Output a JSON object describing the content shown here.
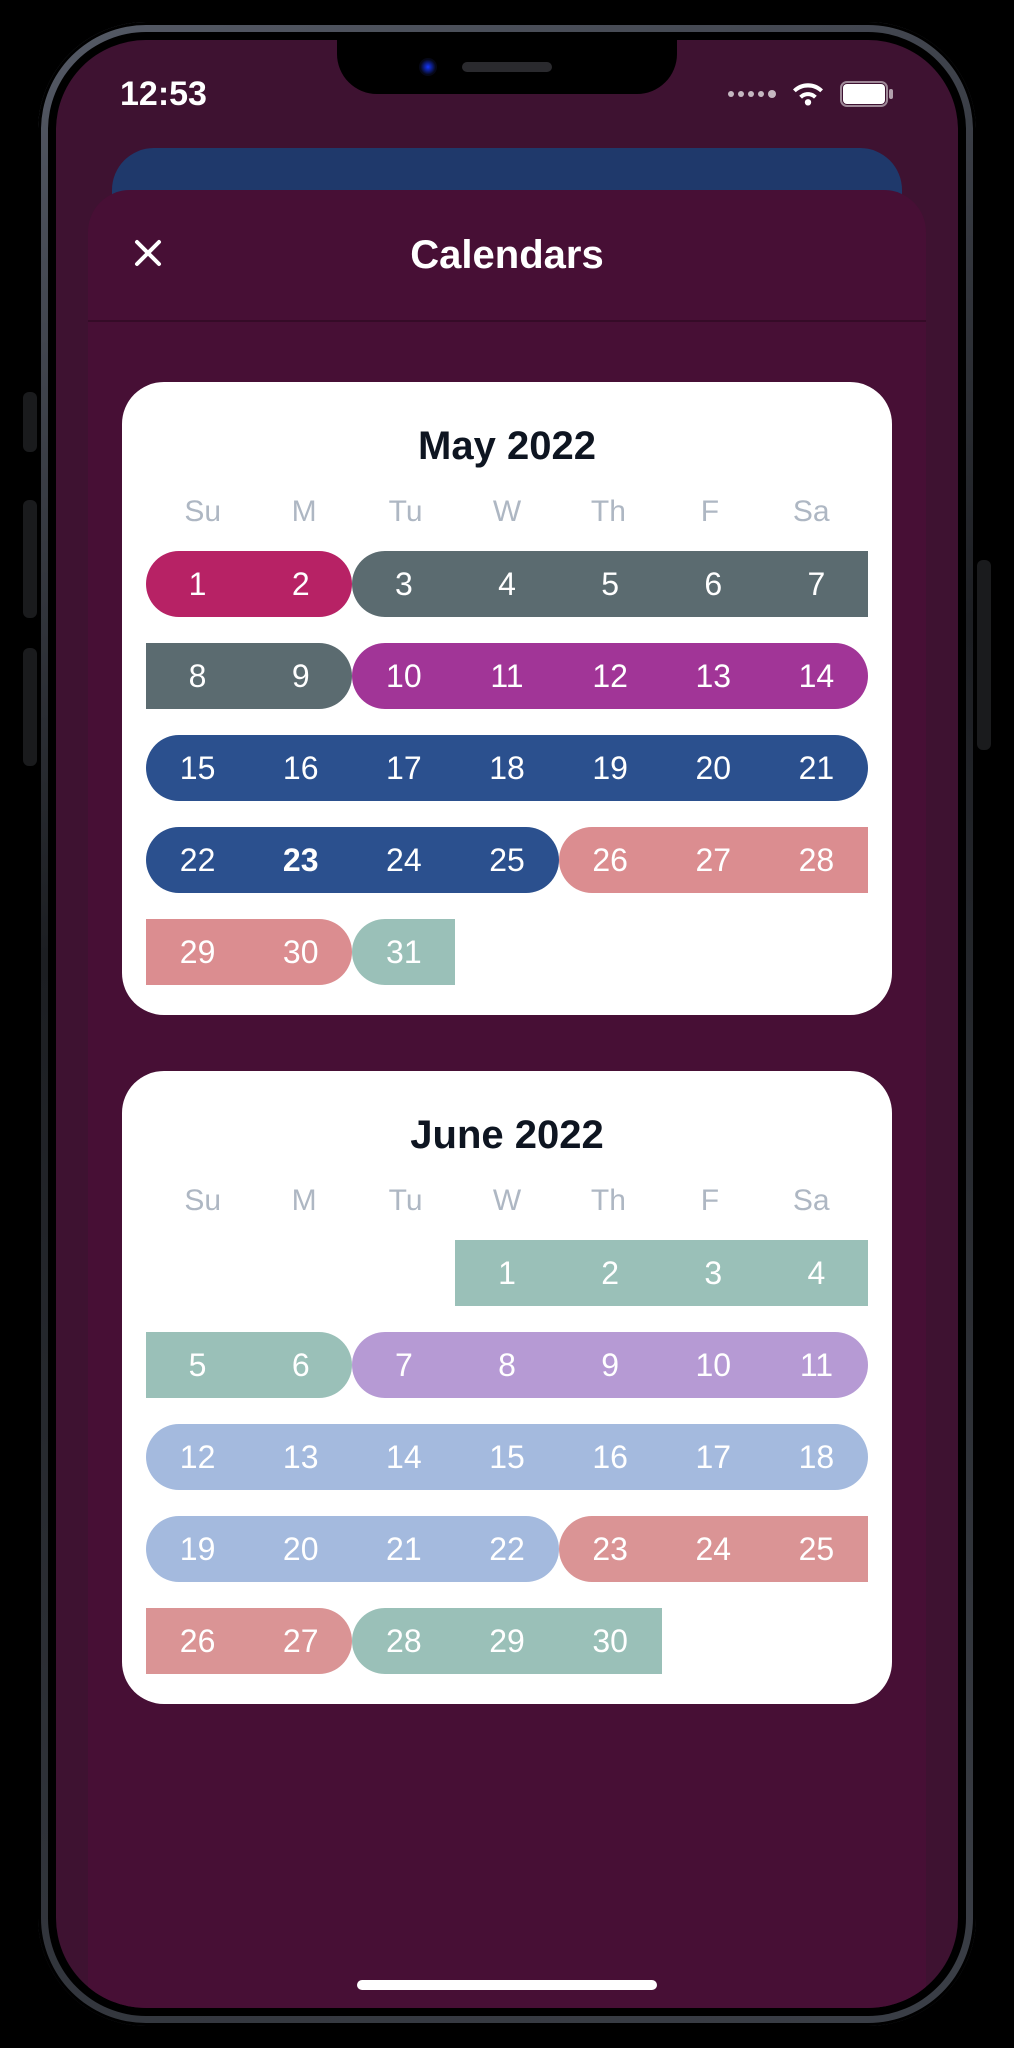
{
  "status": {
    "time": "12:53"
  },
  "header": {
    "title": "Calendars"
  },
  "colors": {
    "pink": "#b72265",
    "slate": "#5b6b70",
    "purple": "#a13597",
    "navy": "#2b508e",
    "salmon": "#db8d90",
    "teal": "#9ac0b8",
    "lavender": "#b69ad4",
    "skyblue": "#a4bade",
    "salmon2": "#da9495"
  },
  "weekdays": [
    "Su",
    "M",
    "Tu",
    "W",
    "Th",
    "F",
    "Sa"
  ],
  "months": [
    {
      "title": "May 2022",
      "weeks": [
        {
          "days": [
            1,
            2,
            3,
            4,
            5,
            6,
            7
          ],
          "segments": [
            {
              "start": 0,
              "end": 1,
              "color": "pink"
            },
            {
              "start": 2,
              "end": 6,
              "color": "slate",
              "openRight": true
            }
          ]
        },
        {
          "days": [
            8,
            9,
            10,
            11,
            12,
            13,
            14
          ],
          "segments": [
            {
              "start": 0,
              "end": 1,
              "color": "slate",
              "openLeft": true
            },
            {
              "start": 2,
              "end": 6,
              "color": "purple"
            }
          ]
        },
        {
          "days": [
            15,
            16,
            17,
            18,
            19,
            20,
            21
          ],
          "segments": [
            {
              "start": 0,
              "end": 6,
              "color": "navy"
            }
          ]
        },
        {
          "days": [
            22,
            23,
            24,
            25,
            26,
            27,
            28
          ],
          "bold": [
            23
          ],
          "segments": [
            {
              "start": 0,
              "end": 3,
              "color": "navy"
            },
            {
              "start": 4,
              "end": 6,
              "color": "salmon",
              "openRight": true
            }
          ]
        },
        {
          "days": [
            29,
            30,
            31,
            null,
            null,
            null,
            null
          ],
          "segments": [
            {
              "start": 0,
              "end": 1,
              "color": "salmon",
              "openLeft": true
            },
            {
              "start": 2,
              "end": 2,
              "color": "teal",
              "openRight": true
            }
          ]
        }
      ]
    },
    {
      "title": "June 2022",
      "weeks": [
        {
          "days": [
            null,
            null,
            null,
            1,
            2,
            3,
            4
          ],
          "segments": [
            {
              "start": 3,
              "end": 6,
              "color": "teal",
              "openLeft": true,
              "openRight": true
            }
          ]
        },
        {
          "days": [
            5,
            6,
            7,
            8,
            9,
            10,
            11
          ],
          "segments": [
            {
              "start": 0,
              "end": 1,
              "color": "teal",
              "openLeft": true
            },
            {
              "start": 2,
              "end": 6,
              "color": "lavender"
            }
          ]
        },
        {
          "days": [
            12,
            13,
            14,
            15,
            16,
            17,
            18
          ],
          "segments": [
            {
              "start": 0,
              "end": 6,
              "color": "skyblue"
            }
          ]
        },
        {
          "days": [
            19,
            20,
            21,
            22,
            23,
            24,
            25
          ],
          "segments": [
            {
              "start": 0,
              "end": 3,
              "color": "skyblue"
            },
            {
              "start": 4,
              "end": 6,
              "color": "salmon2",
              "openRight": true
            }
          ]
        },
        {
          "days": [
            26,
            27,
            28,
            29,
            30,
            null,
            null
          ],
          "segments": [
            {
              "start": 0,
              "end": 1,
              "color": "salmon2",
              "openLeft": true
            },
            {
              "start": 2,
              "end": 4,
              "color": "teal",
              "openRight": true
            }
          ]
        }
      ]
    }
  ]
}
